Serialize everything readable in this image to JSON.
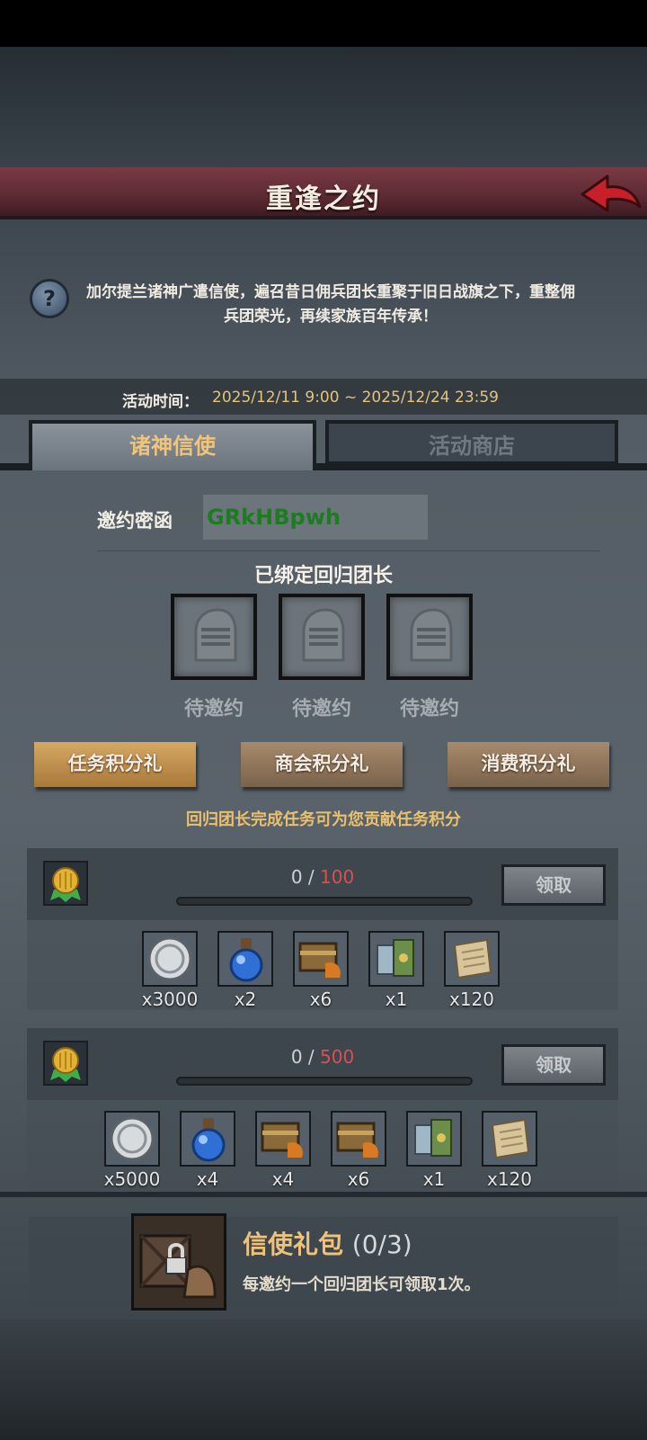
{
  "header": {
    "title": "重逢之约"
  },
  "description": "加尔提兰诸神广遣信使，遍召昔日佣兵团长重聚于旧日战旗之下，重整佣兵团荣光，再续家族百年传承！",
  "event_time": {
    "label": "活动时间：",
    "value": "2025/12/11 9:00 ~ 2025/12/24 23:59"
  },
  "tabs": [
    {
      "label": "诸神信使",
      "active": true
    },
    {
      "label": "活动商店",
      "active": false
    }
  ],
  "invite": {
    "label": "邀约密函",
    "code": "GRkHBpwh"
  },
  "bound": {
    "title": "已绑定回归团长",
    "slots": [
      "待邀约",
      "待邀约",
      "待邀约"
    ]
  },
  "subtabs": [
    {
      "label": "任务积分礼",
      "active": true
    },
    {
      "label": "商会积分礼",
      "active": false
    },
    {
      "label": "消费积分礼",
      "active": false
    }
  ],
  "hint": "回归团长完成任务可为您贡献任务积分",
  "rewards": [
    {
      "current": "0",
      "separator": " / ",
      "target": "100",
      "claim_label": "领取",
      "items": [
        {
          "icon": "silver-coin-icon",
          "count": "x3000"
        },
        {
          "icon": "blue-potion-icon",
          "count": "x2"
        },
        {
          "icon": "treasure-chest-icon",
          "count": "x6"
        },
        {
          "icon": "scroll-bundle-icon",
          "count": "x1"
        },
        {
          "icon": "parchment-scroll-icon",
          "count": "x120"
        }
      ]
    },
    {
      "current": "0",
      "separator": " / ",
      "target": "500",
      "claim_label": "领取",
      "items": [
        {
          "icon": "silver-coin-icon",
          "count": "x5000"
        },
        {
          "icon": "blue-potion-icon",
          "count": "x4"
        },
        {
          "icon": "treasure-chest-icon",
          "count": "x4"
        },
        {
          "icon": "treasure-chest-icon",
          "count": "x6"
        },
        {
          "icon": "scroll-bundle-icon",
          "count": "x1"
        },
        {
          "icon": "parchment-scroll-icon",
          "count": "x120"
        }
      ]
    }
  ],
  "gift": {
    "title": "信使礼包",
    "count": "(0/3)",
    "desc": "每邀约一个回归团长可领取1次。"
  },
  "colors": {
    "accent_gold": "#e9c06e",
    "banner_red": "#6b313a",
    "target_red": "#d94f52",
    "code_green": "#1f7b21"
  }
}
